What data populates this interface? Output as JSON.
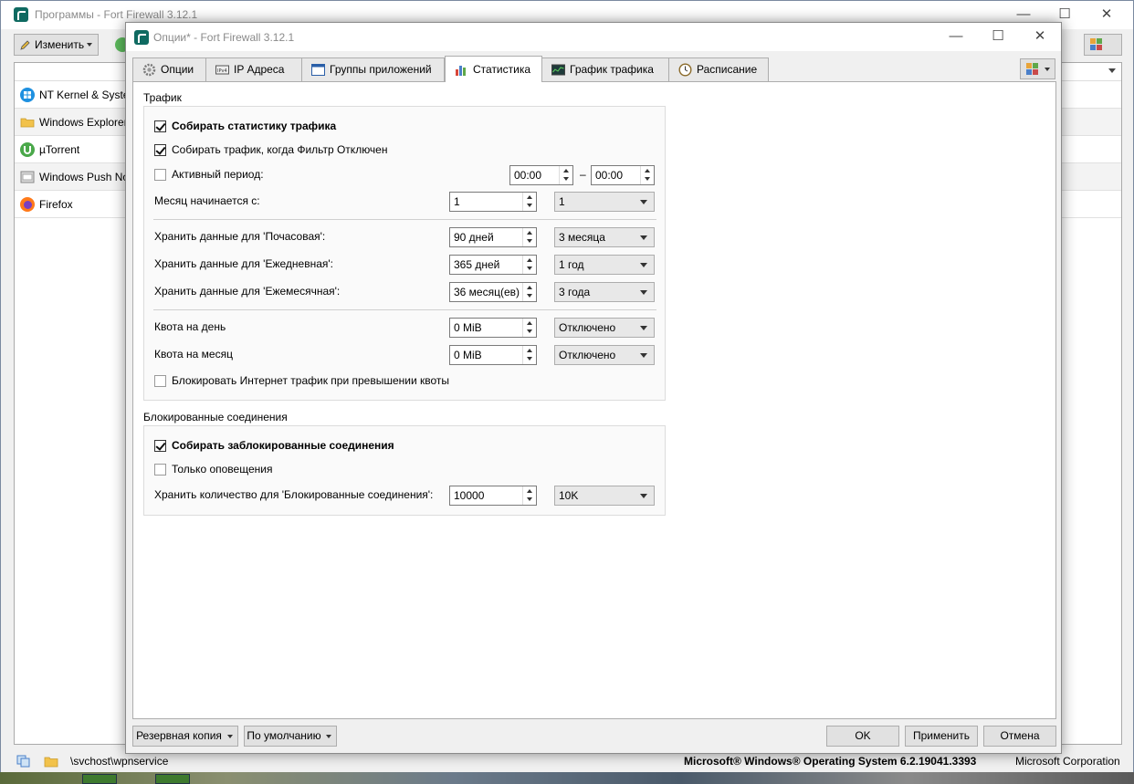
{
  "main_window": {
    "title": "Программы - Fort Firewall 3.12.1",
    "toolbar": {
      "edit_label": "Изменить"
    },
    "programs": [
      {
        "name": "NT Kernel & System",
        "icon": "windows-icon"
      },
      {
        "name": "Windows Explorer",
        "icon": "folder-icon"
      },
      {
        "name": "µTorrent",
        "icon": "utorrent-icon"
      },
      {
        "name": "Windows Push Notifications",
        "icon": "service-icon"
      },
      {
        "name": "Firefox",
        "icon": "firefox-icon"
      }
    ],
    "status": {
      "path": "\\svchost\\wpnservice",
      "product": "Microsoft® Windows® Operating System 6.2.19041.3393",
      "company": "Microsoft Corporation"
    }
  },
  "dialog": {
    "title": "Опции* - Fort Firewall 3.12.1",
    "tabs": [
      {
        "label": "Опции",
        "icon": "gear-icon"
      },
      {
        "label": "IP Адреса",
        "icon": "ip-icon"
      },
      {
        "label": "Группы приложений",
        "icon": "window-icon"
      },
      {
        "label": "Статистика",
        "icon": "chart-icon",
        "active": true
      },
      {
        "label": "График трафика",
        "icon": "graph-icon"
      },
      {
        "label": "Расписание",
        "icon": "clock-icon"
      }
    ],
    "traffic": {
      "title": "Трафик",
      "collect_stats": {
        "label": "Собирать статистику трафика",
        "checked": true
      },
      "collect_when_off": {
        "label": "Собирать трафик, когда Фильтр Отключен",
        "checked": true
      },
      "active_period": {
        "label": "Активный период:",
        "checked": false,
        "from": "00:00",
        "dash": "–",
        "to": "00:00"
      },
      "month_start": {
        "label": "Месяц начинается с:",
        "value": "1",
        "combo": "1"
      },
      "keep_hourly": {
        "label": "Хранить данные для 'Почасовая':",
        "value": "90 дней",
        "combo": "3 месяца"
      },
      "keep_daily": {
        "label": "Хранить данные для 'Ежедневная':",
        "value": "365 дней",
        "combo": "1 год"
      },
      "keep_monthly": {
        "label": "Хранить данные для 'Ежемесячная':",
        "value": "36 месяц(ев)",
        "combo": "3 года"
      },
      "quota_day": {
        "label": "Квота на день",
        "value": "0 MiB",
        "combo": "Отключено"
      },
      "quota_month": {
        "label": "Квота на месяц",
        "value": "0 MiB",
        "combo": "Отключено"
      },
      "block_on_quota": {
        "label": "Блокировать Интернет трафик при превышении квоты",
        "checked": false
      }
    },
    "blocked": {
      "title": "Блокированные соединения",
      "collect_blocked": {
        "label": "Собирать заблокированные соединения",
        "checked": true
      },
      "alerts_only": {
        "label": "Только оповещения",
        "checked": false
      },
      "keep_count": {
        "label": "Хранить количество для 'Блокированные соединения':",
        "value": "10000",
        "combo": "10K"
      }
    },
    "buttons": {
      "backup": "Резервная копия",
      "defaults": "По умолчанию",
      "ok": "OK",
      "apply": "Применить",
      "cancel": "Отмена"
    }
  }
}
